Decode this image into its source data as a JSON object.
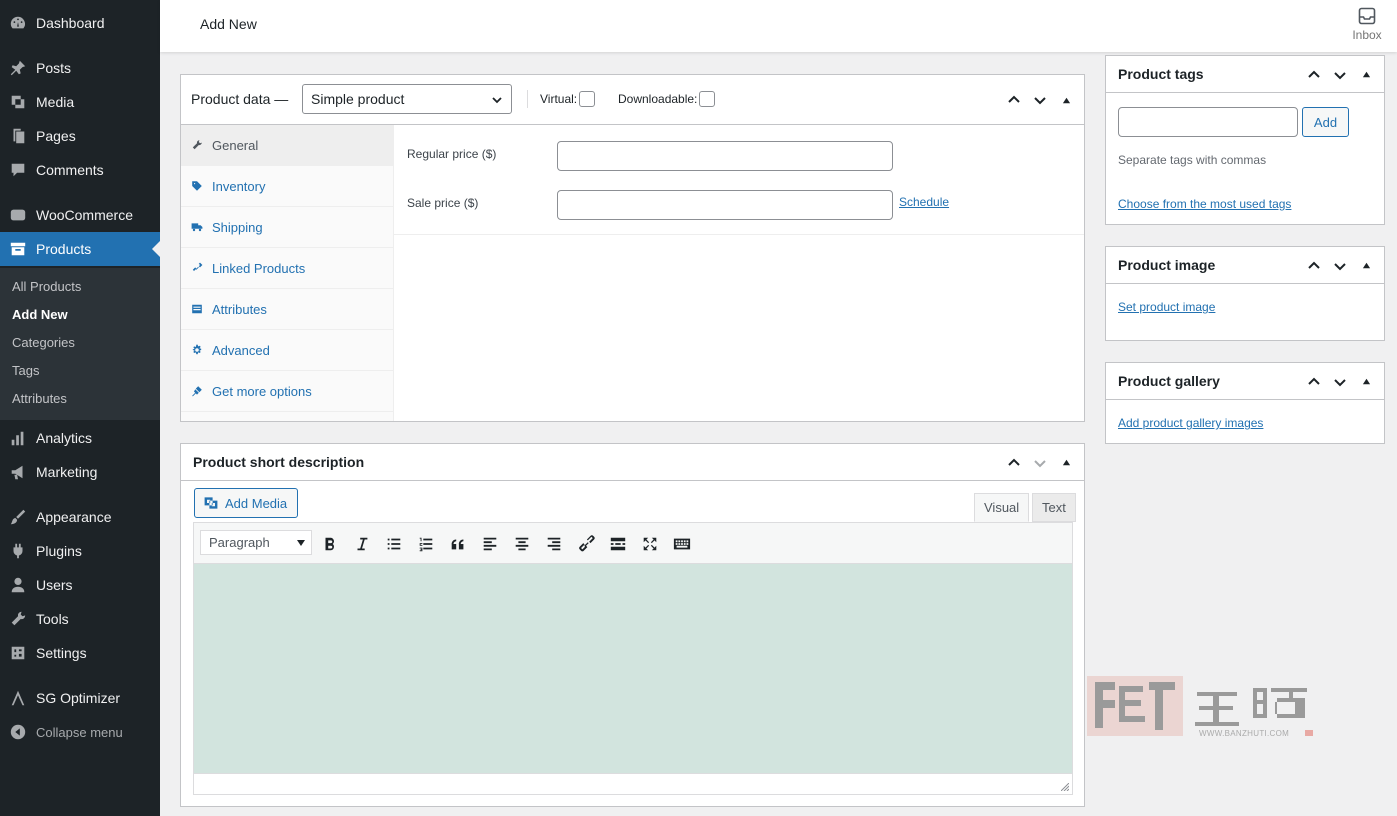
{
  "sidebar": {
    "items": [
      {
        "label": "Dashboard",
        "icon": "dashboard-icon"
      },
      {
        "label": "Posts",
        "icon": "pin-icon"
      },
      {
        "label": "Media",
        "icon": "media-icon"
      },
      {
        "label": "Pages",
        "icon": "pages-icon"
      },
      {
        "label": "Comments",
        "icon": "comments-icon"
      },
      {
        "label": "WooCommerce",
        "icon": "woo-icon"
      },
      {
        "label": "Products",
        "icon": "archive-icon",
        "active": true
      },
      {
        "label": "Analytics",
        "icon": "bar-chart-icon"
      },
      {
        "label": "Marketing",
        "icon": "megaphone-icon"
      },
      {
        "label": "Appearance",
        "icon": "brush-icon"
      },
      {
        "label": "Plugins",
        "icon": "plugin-icon"
      },
      {
        "label": "Users",
        "icon": "user-icon"
      },
      {
        "label": "Tools",
        "icon": "wrench-icon"
      },
      {
        "label": "Settings",
        "icon": "settings-icon"
      },
      {
        "label": "SG Optimizer",
        "icon": "sg-icon"
      }
    ],
    "submenu": [
      "All Products",
      "Add New",
      "Categories",
      "Tags",
      "Attributes"
    ],
    "submenu_current": "Add New",
    "collapse_label": "Collapse menu"
  },
  "header": {
    "title": "Add New",
    "inbox_label": "Inbox"
  },
  "product_data": {
    "title": "Product data —",
    "type_selected": "Simple product",
    "virtual_label": "Virtual:",
    "downloadable_label": "Downloadable:",
    "tabs": [
      {
        "label": "General",
        "icon": "wrench-icon"
      },
      {
        "label": "Inventory",
        "icon": "tag-icon"
      },
      {
        "label": "Shipping",
        "icon": "truck-icon"
      },
      {
        "label": "Linked Products",
        "icon": "link-icon"
      },
      {
        "label": "Attributes",
        "icon": "list-icon"
      },
      {
        "label": "Advanced",
        "icon": "gear-icon"
      },
      {
        "label": "Get more options",
        "icon": "plug-icon"
      }
    ],
    "regular_price_label": "Regular price ($)",
    "sale_price_label": "Sale price ($)",
    "schedule_label": "Schedule"
  },
  "short_description": {
    "title": "Product short description",
    "add_media_label": "Add Media",
    "tab_visual": "Visual",
    "tab_text": "Text",
    "format_selected": "Paragraph"
  },
  "side": {
    "tags": {
      "title": "Product tags",
      "add_label": "Add",
      "hint": "Separate tags with commas",
      "link": "Choose from the most used tags"
    },
    "image": {
      "title": "Product image",
      "link": "Set product image"
    },
    "gallery": {
      "title": "Product gallery",
      "link": "Add product gallery images"
    }
  },
  "watermark": {
    "text": "搬主题",
    "url": "WWW.BANZHUTI.COM"
  },
  "colors": {
    "sidebar_bg": "#1d2327",
    "active_bg": "#2271b1",
    "link": "#2271b1",
    "editor_bg": "#d2e4de"
  }
}
